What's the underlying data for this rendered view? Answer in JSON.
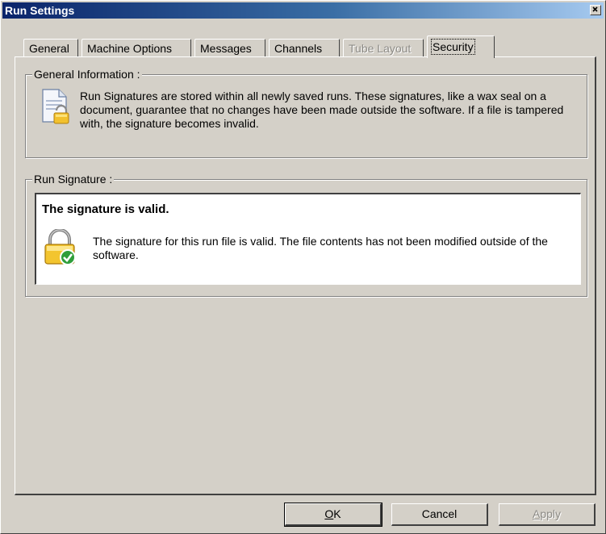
{
  "window": {
    "title": "Run Settings",
    "close_label": "×"
  },
  "tabs": [
    {
      "label": "General",
      "state": "normal"
    },
    {
      "label": "Machine Options",
      "state": "normal"
    },
    {
      "label": "Messages",
      "state": "normal"
    },
    {
      "label": "Channels",
      "state": "normal"
    },
    {
      "label": "Tube Layout",
      "state": "disabled"
    },
    {
      "label": "Security",
      "state": "active"
    }
  ],
  "general_info": {
    "legend": "General Information :",
    "text": "Run Signatures are stored within all newly saved runs. These signatures, like a wax seal on a document, guarantee that no changes have been made outside the software. If a file is tampered with, the signature becomes invalid.",
    "icon": "signed-document-icon"
  },
  "run_signature": {
    "legend": "Run Signature :",
    "heading": "The signature is valid.",
    "text": "The signature for this run file is valid. The file contents has not been modified outside of the software.",
    "icon": "lock-valid-icon"
  },
  "buttons": {
    "ok": {
      "mnemonic": "O",
      "rest": "K"
    },
    "cancel": {
      "label": "Cancel"
    },
    "apply": {
      "mnemonic": "A",
      "rest": "pply"
    }
  },
  "colors": {
    "titlebar_start": "#0a246a",
    "titlebar_end": "#a6caf0",
    "face": "#d4d0c8"
  }
}
